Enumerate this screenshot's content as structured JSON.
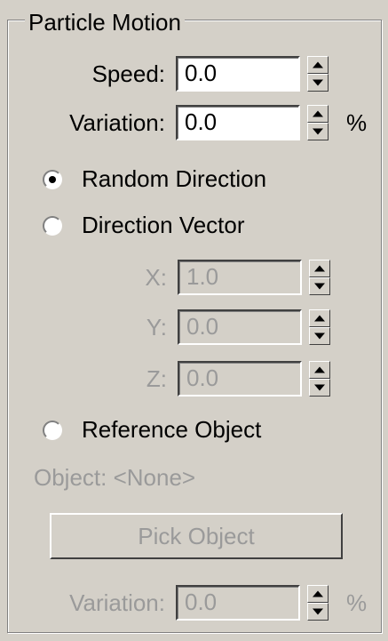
{
  "panel": {
    "title": "Particle Motion"
  },
  "speed": {
    "label": "Speed:",
    "value": "0.0"
  },
  "variation": {
    "label": "Variation:",
    "value": "0.0",
    "unit": "%"
  },
  "direction_options": {
    "random": {
      "label": "Random Direction",
      "selected": true
    },
    "vector": {
      "label": "Direction Vector",
      "selected": false
    },
    "reference": {
      "label": "Reference Object",
      "selected": false
    }
  },
  "vector": {
    "x": {
      "label": "X:",
      "value": "1.0"
    },
    "y": {
      "label": "Y:",
      "value": "0.0"
    },
    "z": {
      "label": "Z:",
      "value": "0.0"
    }
  },
  "reference": {
    "object_label": "Object: <None>",
    "pick_button": "Pick Object",
    "variation": {
      "label": "Variation:",
      "value": "0.0",
      "unit": "%"
    }
  }
}
